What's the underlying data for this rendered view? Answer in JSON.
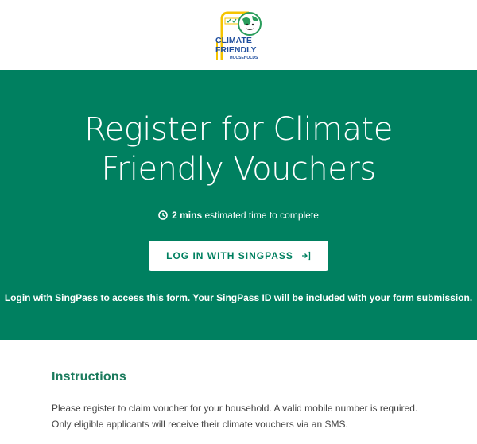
{
  "logo": {
    "line1": "CLIMATE",
    "line2": "FRIENDLY",
    "line3": "HOUSEHOLDS"
  },
  "hero": {
    "title_line1": "Register for Climate",
    "title_line2": "Friendly Vouchers",
    "time_value": "2 mins",
    "time_suffix": "estimated time to complete",
    "login_button": "LOG IN WITH SINGPASS",
    "login_note": "Login with SingPass to access this form. Your SingPass ID will be included with your form submission."
  },
  "instructions": {
    "heading": "Instructions",
    "line1": "Please register to claim voucher for your household. A valid mobile number is required.",
    "line2": "Only eligible applicants will receive their climate vouchers via an SMS."
  },
  "colors": {
    "brand_green": "#008060",
    "heading_green": "#1a7a5c"
  }
}
